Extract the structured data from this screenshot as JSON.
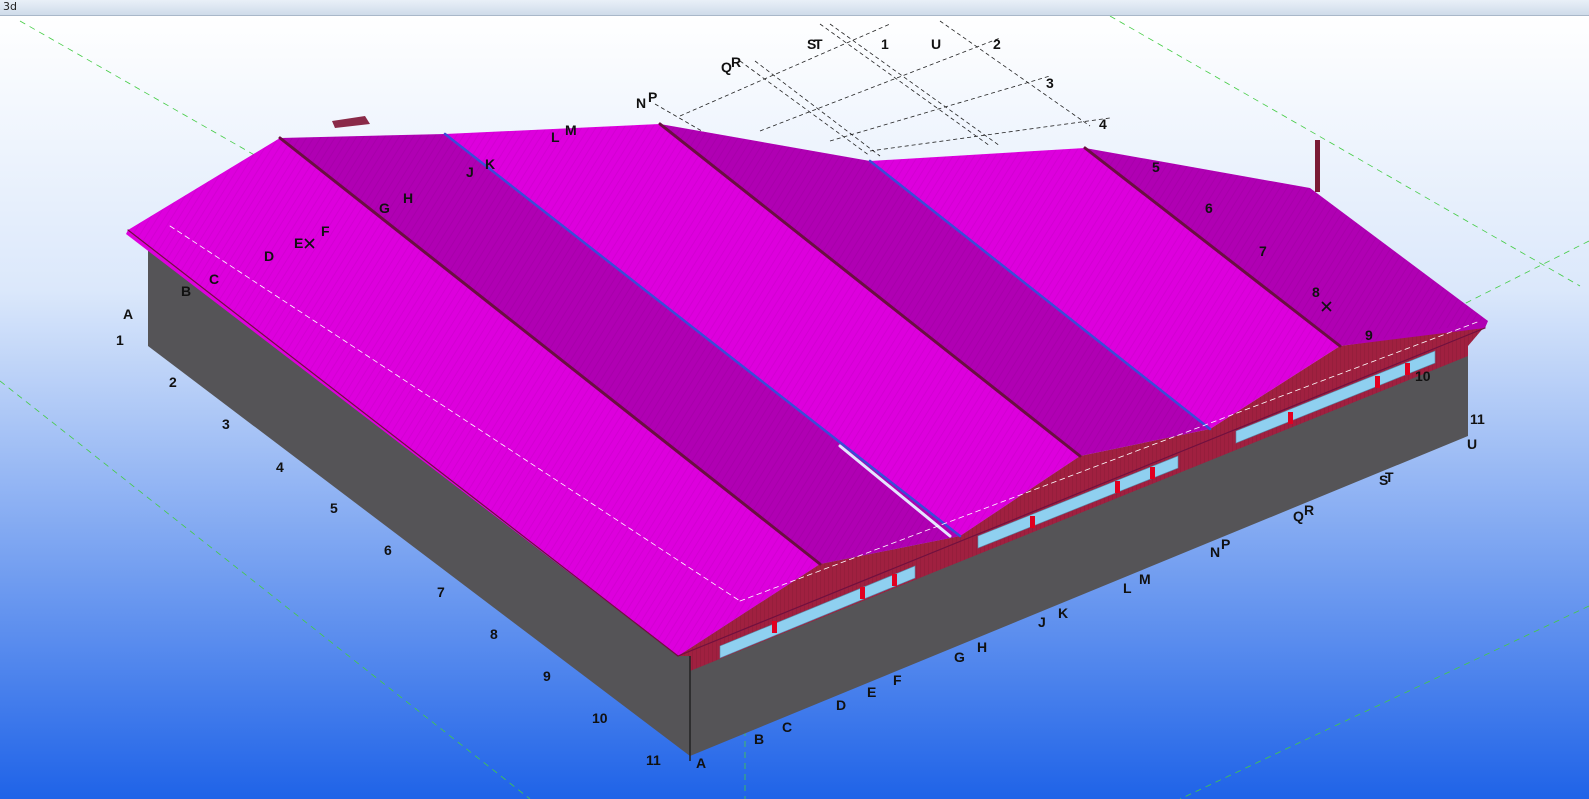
{
  "window": {
    "title": "3d"
  },
  "colors": {
    "background_top": "#ffffff",
    "background_bottom": "#1f63e8",
    "roof": "#dd00dd",
    "roof_dark": "#b000b3",
    "gable_wall": "#a02040",
    "side_wall": "#555457",
    "window_strip": "#8fd0f0",
    "grid_line": "#222222",
    "axis_green": "#44cc44"
  },
  "grid": {
    "near_edge_labels": [
      "1",
      "2",
      "3",
      "4",
      "5",
      "6",
      "7",
      "8",
      "9",
      "10",
      "11"
    ],
    "front_edge_labels": [
      "A",
      "B",
      "C",
      "D",
      "E",
      "F",
      "G",
      "H",
      "J",
      "K",
      "L",
      "M",
      "N",
      "P",
      "Q",
      "R",
      "S",
      "T",
      "U"
    ],
    "far_number_labels": [
      "1",
      "2",
      "3",
      "4",
      "5",
      "6",
      "7",
      "8",
      "9",
      "10",
      "11"
    ],
    "far_letter_labels": [
      "A",
      "B",
      "C",
      "D",
      "E",
      "F",
      "G",
      "H",
      "J",
      "K",
      "L",
      "M",
      "N",
      "P",
      "Q",
      "R",
      "S",
      "T",
      "U"
    ]
  }
}
